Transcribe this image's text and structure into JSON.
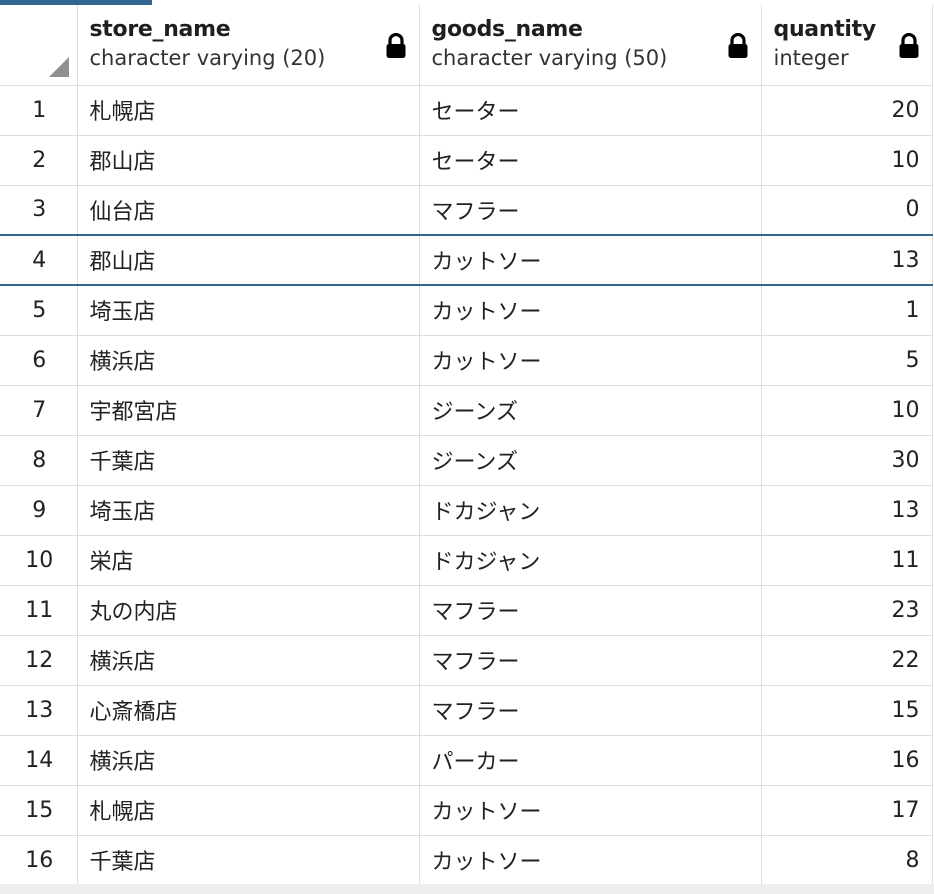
{
  "grid": {
    "columns": [
      {
        "name": "store_name",
        "type": "character varying (20)"
      },
      {
        "name": "goods_name",
        "type": "character varying (50)"
      },
      {
        "name": "quantity",
        "type": "integer"
      }
    ],
    "selected_row": 4,
    "rows": [
      {
        "n": "1",
        "store": "札幌店",
        "goods": "セーター",
        "qty": "20"
      },
      {
        "n": "2",
        "store": "郡山店",
        "goods": "セーター",
        "qty": "10"
      },
      {
        "n": "3",
        "store": "仙台店",
        "goods": "マフラー",
        "qty": "0"
      },
      {
        "n": "4",
        "store": "郡山店",
        "goods": "カットソー",
        "qty": "13"
      },
      {
        "n": "5",
        "store": "埼玉店",
        "goods": "カットソー",
        "qty": "1"
      },
      {
        "n": "6",
        "store": "横浜店",
        "goods": "カットソー",
        "qty": "5"
      },
      {
        "n": "7",
        "store": "宇都宮店",
        "goods": "ジーンズ",
        "qty": "10"
      },
      {
        "n": "8",
        "store": "千葉店",
        "goods": "ジーンズ",
        "qty": "30"
      },
      {
        "n": "9",
        "store": "埼玉店",
        "goods": "ドカジャン",
        "qty": "13"
      },
      {
        "n": "10",
        "store": "栄店",
        "goods": "ドカジャン",
        "qty": "11"
      },
      {
        "n": "11",
        "store": "丸の内店",
        "goods": "マフラー",
        "qty": "23"
      },
      {
        "n": "12",
        "store": "横浜店",
        "goods": "マフラー",
        "qty": "22"
      },
      {
        "n": "13",
        "store": "心斎橋店",
        "goods": "マフラー",
        "qty": "15"
      },
      {
        "n": "14",
        "store": "横浜店",
        "goods": "パーカー",
        "qty": "16"
      },
      {
        "n": "15",
        "store": "札幌店",
        "goods": "カットソー",
        "qty": "17"
      },
      {
        "n": "16",
        "store": "千葉店",
        "goods": "カットソー",
        "qty": "8"
      }
    ]
  },
  "colors": {
    "accent": "#326690",
    "grid_line": "#dddddd",
    "corner_marker": "#909090"
  },
  "icons": {
    "column_lock": "lock-icon",
    "select_all": "select-all-corner-icon"
  }
}
